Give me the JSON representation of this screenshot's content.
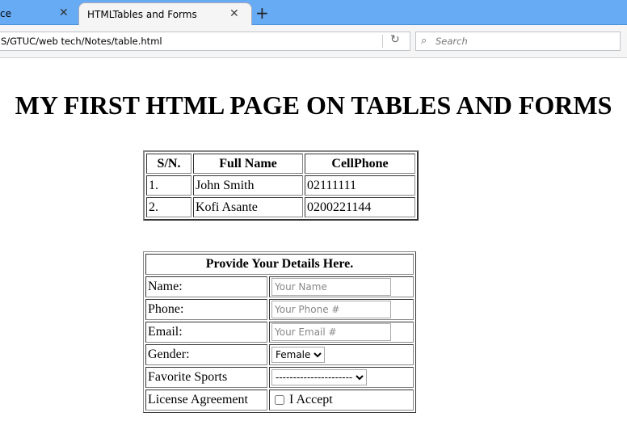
{
  "browser": {
    "tabs": [
      {
        "label": "ce",
        "active": false
      },
      {
        "label": "HTMLTables and Forms",
        "active": true
      }
    ],
    "close_glyph": "✕",
    "newtab_glyph": "+",
    "url": "S/GTUC/web tech/Notes/table.html",
    "reload_glyph": "↻",
    "search_icon": "🔍",
    "search_placeholder": "Search"
  },
  "page": {
    "title": "MY FIRST HTML PAGE ON TABLES AND FORMS",
    "contacts_table": {
      "headers": [
        "S/N.",
        "Full Name",
        "CellPhone"
      ],
      "rows": [
        [
          "1.",
          "John Smith",
          "02111111"
        ],
        [
          "2.",
          "Kofi Asante",
          "0200221144"
        ]
      ]
    },
    "form": {
      "heading": "Provide Your Details Here.",
      "name_label": "Name:",
      "name_placeholder": "Your Name",
      "phone_label": "Phone:",
      "phone_placeholder": "Your Phone #",
      "email_label": "Email:",
      "email_placeholder": "Your Email #",
      "gender_label": "Gender:",
      "gender_selected": "Female",
      "sports_label": "Favorite Sports",
      "sports_selected": "----------------------",
      "license_label": "License Agreement",
      "accept_label": "I Accept",
      "accept_checked": false
    }
  }
}
